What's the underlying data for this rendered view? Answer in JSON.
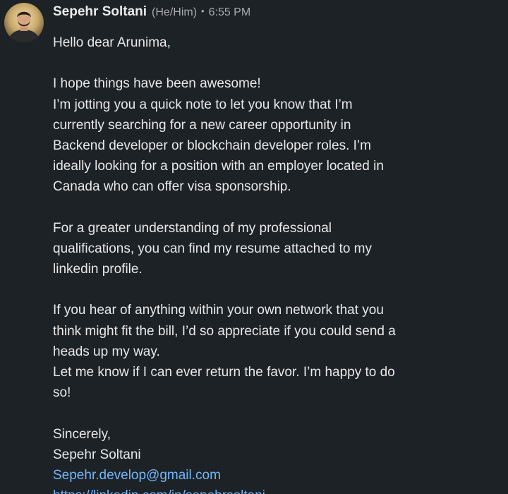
{
  "message": {
    "sender_name": "Sepehr Soltani",
    "pronouns": "(He/Him)",
    "separator": "•",
    "timestamp": "6:55 PM",
    "avatar_icon": "profile-photo-icon",
    "lines": [
      "Hello dear Arunima,",
      "",
      "I hope things have been awesome!",
      "I’m jotting you a quick note to let you know that I’m",
      "currently searching for a new career opportunity in",
      "Backend developer or blockchain developer roles. I’m",
      "ideally looking for a position with an employer located in",
      "Canada who can offer visa sponsorship.",
      "",
      "For a greater understanding of my professional",
      "qualifications, you can find my resume attached to my",
      "linkedin profile.",
      "",
      "If you hear of anything within your own network that you",
      "think might fit the bill, I’d so appreciate if you could send a",
      "heads up my way.",
      "Let me know if I can ever return the favor. I’m happy to do",
      "so!",
      "",
      "Sincerely,",
      "Sepehr Soltani"
    ],
    "email_link": "Sepehr.develop@gmail.com",
    "profile_link": "https://linkedin.com/in/sepehrsoltani"
  },
  "colors": {
    "background": "#1d2226",
    "text": "#e8e8e9",
    "secondary_text": "#a9abae",
    "link": "#71b7fb"
  }
}
